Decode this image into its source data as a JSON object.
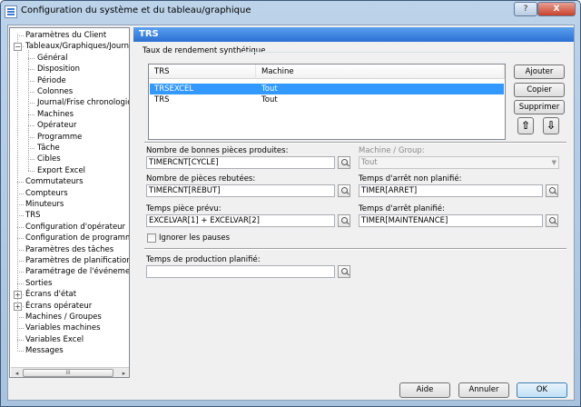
{
  "window": {
    "title": "Configuration du système et du tableau/graphique",
    "help": "?",
    "close": "X"
  },
  "tree": {
    "items": [
      {
        "label": "Paramètres du Client",
        "level": 0,
        "expander": ""
      },
      {
        "label": "Tableaux/Graphiques/Journa",
        "level": 0,
        "expander": "−"
      },
      {
        "label": "Général",
        "level": 1,
        "expander": ""
      },
      {
        "label": "Disposition",
        "level": 1,
        "expander": ""
      },
      {
        "label": "Période",
        "level": 1,
        "expander": ""
      },
      {
        "label": "Colonnes",
        "level": 1,
        "expander": ""
      },
      {
        "label": "Journal/Frise chronologic",
        "level": 1,
        "expander": ""
      },
      {
        "label": "Machines",
        "level": 1,
        "expander": ""
      },
      {
        "label": "Opérateur",
        "level": 1,
        "expander": ""
      },
      {
        "label": "Programme",
        "level": 1,
        "expander": ""
      },
      {
        "label": "Tâche",
        "level": 1,
        "expander": ""
      },
      {
        "label": "Cibles",
        "level": 1,
        "expander": ""
      },
      {
        "label": "Export Excel",
        "level": 1,
        "expander": ""
      },
      {
        "label": "Commutateurs",
        "level": 0,
        "expander": ""
      },
      {
        "label": "Compteurs",
        "level": 0,
        "expander": ""
      },
      {
        "label": "Minuteurs",
        "level": 0,
        "expander": ""
      },
      {
        "label": "TRS",
        "level": 0,
        "expander": ""
      },
      {
        "label": "Configuration d'opérateur",
        "level": 0,
        "expander": ""
      },
      {
        "label": "Configuration de programme",
        "level": 0,
        "expander": ""
      },
      {
        "label": "Paramètres des tâches",
        "level": 0,
        "expander": ""
      },
      {
        "label": "Paramètres de planification",
        "level": 0,
        "expander": ""
      },
      {
        "label": "Paramétrage de l'événement",
        "level": 0,
        "expander": ""
      },
      {
        "label": "Sorties",
        "level": 0,
        "expander": ""
      },
      {
        "label": "Écrans d'état",
        "level": 0,
        "expander": "+"
      },
      {
        "label": "Écrans opérateur",
        "level": 0,
        "expander": "+"
      },
      {
        "label": "Machines / Groupes",
        "level": 0,
        "expander": ""
      },
      {
        "label": "Variables machines",
        "level": 0,
        "expander": ""
      },
      {
        "label": "Variables Excel",
        "level": 0,
        "expander": ""
      },
      {
        "label": "Messages",
        "level": 0,
        "expander": ""
      }
    ],
    "scroll_left": "◂",
    "scroll_right": "▸",
    "scroll_grip": "III"
  },
  "panel": {
    "title": "TRS",
    "group_label": "Taux de rendement synthétique",
    "list": {
      "columns": [
        "TRS",
        "Machine"
      ],
      "rows": [
        {
          "trs": "TRSEXCEL",
          "machine": "Tout",
          "selected": true
        },
        {
          "trs": "TRS",
          "machine": "Tout",
          "selected": false
        }
      ]
    },
    "buttons": {
      "add": "Ajouter",
      "copy": "Copier",
      "delete": "Supprimer",
      "up": "⇧",
      "down": "⇩"
    },
    "good_parts": {
      "label": "Nombre de bonnes pièces produites:",
      "value": "TIMERCNT[CYCLE]"
    },
    "machine_group": {
      "label": "Machine / Group:",
      "value": "Tout"
    },
    "rejected_parts": {
      "label": "Nombre de pièces rebutées:",
      "value": "TIMERCNT[REBUT]"
    },
    "unplanned_stop": {
      "label": "Temps d'arrêt non planifié:",
      "value": "TIMER[ARRET]"
    },
    "cycle_time": {
      "label": "Temps pièce prévu:",
      "value": "EXCELVAR[1] + EXCELVAR[2]"
    },
    "planned_stop": {
      "label": "Temps d'arrêt planifié:",
      "value": "TIMER[MAINTENANCE]"
    },
    "ignore_pauses": {
      "label": "Ignorer les pauses",
      "checked": false
    },
    "planned_production": {
      "label": "Temps de production planifié:",
      "value": ""
    }
  },
  "footer": {
    "help": "Aide",
    "cancel": "Annuler",
    "ok": "OK"
  }
}
